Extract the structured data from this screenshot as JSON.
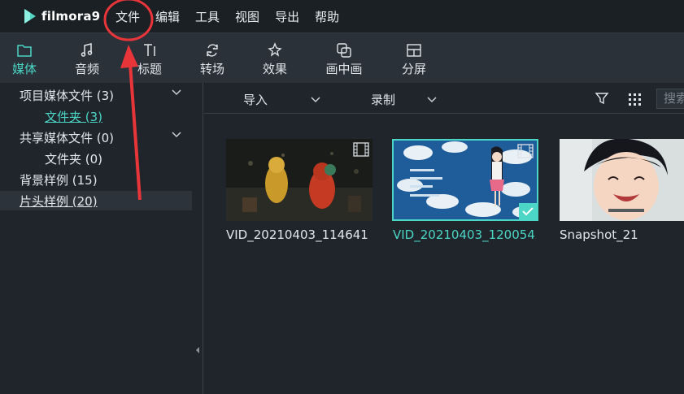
{
  "app": {
    "logo_text": "filmora9"
  },
  "menu": [
    "文件",
    "编辑",
    "工具",
    "视图",
    "导出",
    "帮助"
  ],
  "toolbar": {
    "tabs": [
      {
        "label": "媒体",
        "icon": "folder-icon"
      },
      {
        "label": "音频",
        "icon": "music-note-icon"
      },
      {
        "label": "标题",
        "icon": "text-title-icon"
      },
      {
        "label": "转场",
        "icon": "transition-icon"
      },
      {
        "label": "效果",
        "icon": "effects-icon"
      },
      {
        "label": "画中画",
        "icon": "picture-in-picture-icon"
      },
      {
        "label": "分屏",
        "icon": "split-screen-icon"
      }
    ],
    "active": "媒体"
  },
  "library_tree": [
    {
      "label": "项目媒体文件 (3)",
      "expandable": true
    },
    {
      "label": "文件夹 (3)",
      "child": true,
      "active": true
    },
    {
      "label": "共享媒体文件 (0)",
      "expandable": true
    },
    {
      "label": "文件夹 (0)",
      "child": true
    },
    {
      "label": "背景样例 (15)"
    },
    {
      "label": "片头样例 (20)",
      "selected": true
    }
  ],
  "filterbar": {
    "import_label": "导入",
    "record_label": "录制",
    "search_placeholder": "搜索"
  },
  "media": [
    {
      "name": "VID_20210403_114641",
      "type": "video",
      "selected": false
    },
    {
      "name": "VID_20210403_120054",
      "type": "video",
      "selected": true
    },
    {
      "name": "Snapshot_21",
      "type": "image",
      "selected": false
    }
  ],
  "colors": {
    "accent": "#4bd6c6",
    "annotation": "#e8353a",
    "background": "#1f252b"
  }
}
